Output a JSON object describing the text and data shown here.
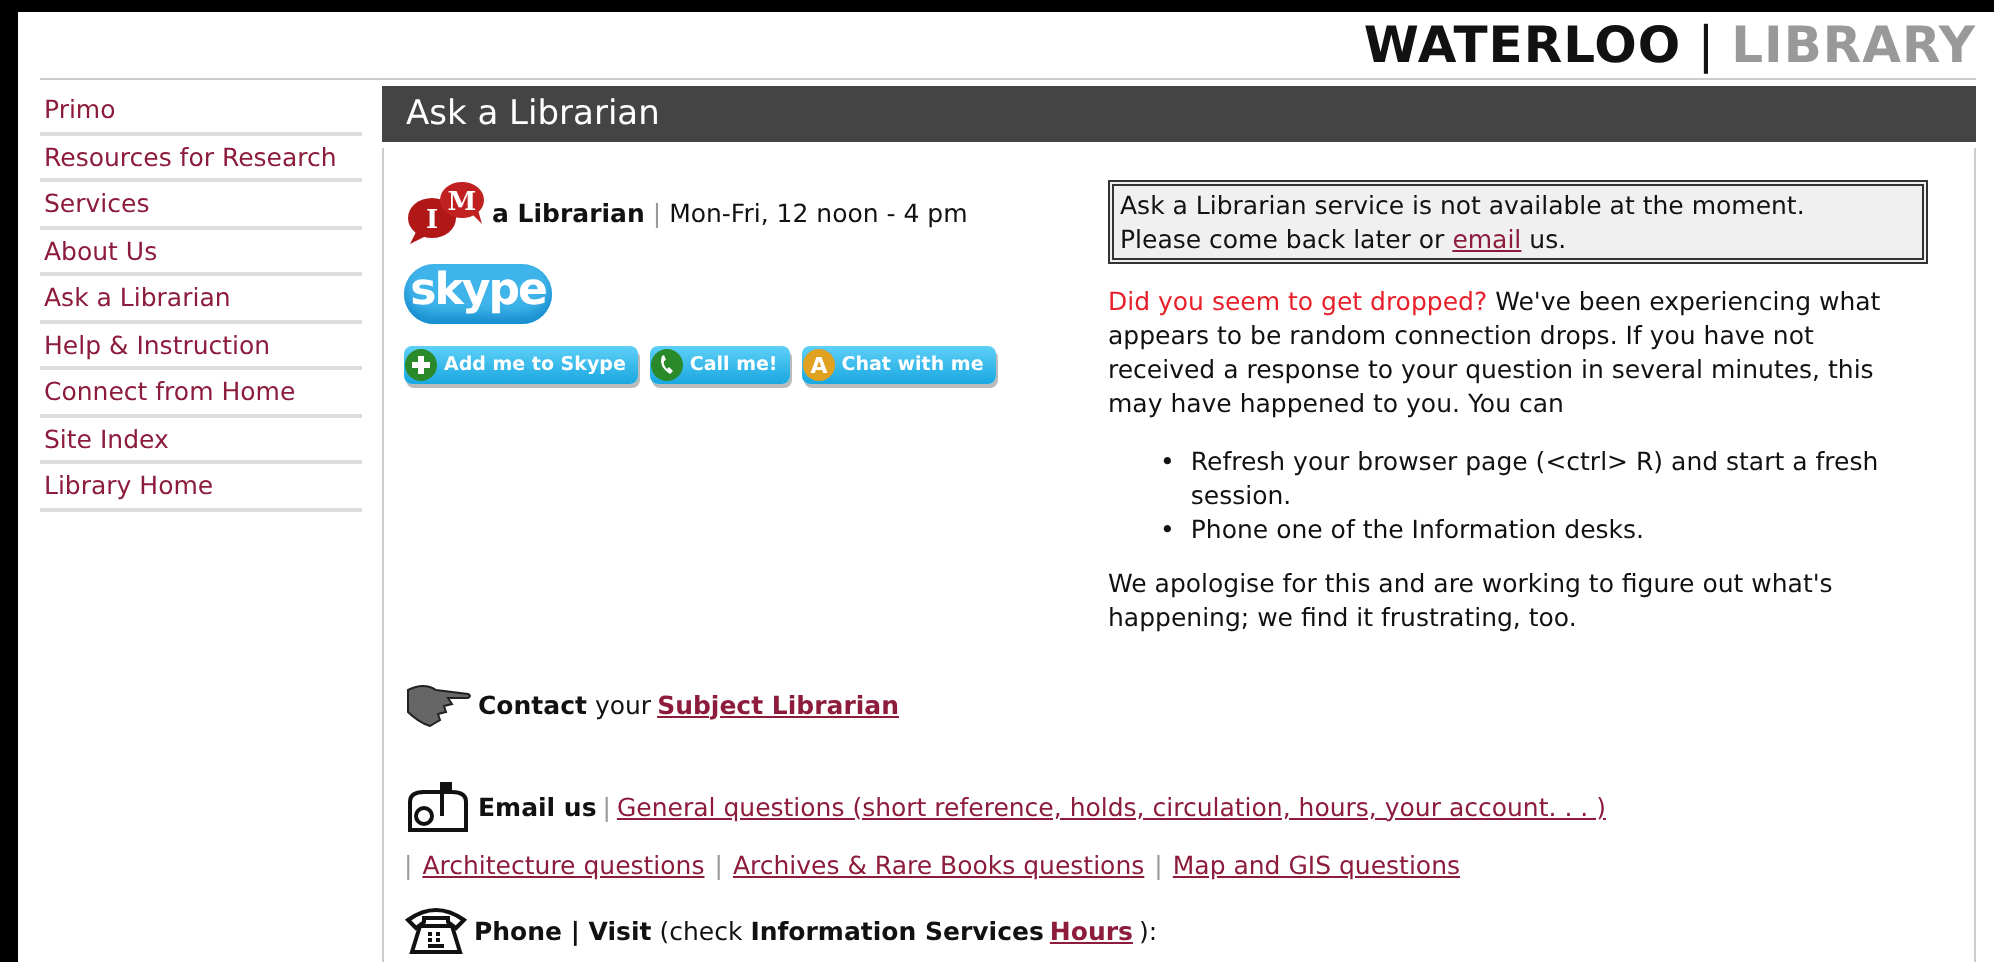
{
  "logo": {
    "primary": "WATERLOO",
    "separator": "|",
    "secondary": "LIBRARY"
  },
  "nav": [
    {
      "label": "Primo"
    },
    {
      "label": "Resources for Research"
    },
    {
      "label": "Services"
    },
    {
      "label": "About Us"
    },
    {
      "label": "Ask a Librarian"
    },
    {
      "label": "Help & Instruction"
    },
    {
      "label": "Connect from Home"
    },
    {
      "label": "Site Index"
    },
    {
      "label": "Library Home"
    }
  ],
  "heading": "Ask a Librarian",
  "im": {
    "badge_letters": [
      "I",
      "M"
    ],
    "title": "a Librarian",
    "separator": "|",
    "hours": "Mon-Fri, 12 noon - 4 pm"
  },
  "skype_logo": "skype",
  "skype_buttons": [
    {
      "kind": "add",
      "label": "Add me to Skype"
    },
    {
      "kind": "call",
      "label": "Call me!"
    },
    {
      "kind": "chat",
      "label": "Chat with me",
      "badge": "A"
    }
  ],
  "notice": {
    "line1": "Ask a Librarian service is not available at the moment.",
    "before_link": "Please come back later or",
    "link": "email",
    "after_link": "us."
  },
  "dropped": {
    "alert": "Did you seem to get dropped?",
    "text": "We've been experiencing what appears to be random connection drops. If you have not received a response to your question in several minutes, this may have happened to you. You can"
  },
  "tips": [
    {
      "marker": "•",
      "text": "Refresh your browser page (<ctrl> R) and start a fresh session."
    },
    {
      "marker": "•",
      "text": "Phone one of the Information desks."
    }
  ],
  "apology": "We apologise for this and are working to figure out what's happening; we find it frustrating, too.",
  "contact": {
    "label": "Contact",
    "text": "your",
    "link": "Subject Librarian"
  },
  "email": {
    "label": "Email us",
    "separator": "|",
    "links": [
      "General questions (short reference, holds, circulation, hours, your account. . . )",
      "Architecture questions",
      "Archives & Rare Books questions",
      "Map and GIS questions"
    ]
  },
  "phone": {
    "label": "Phone | Visit",
    "before": "(check",
    "bold": "Information Services",
    "link": "Hours",
    "after": "):"
  }
}
